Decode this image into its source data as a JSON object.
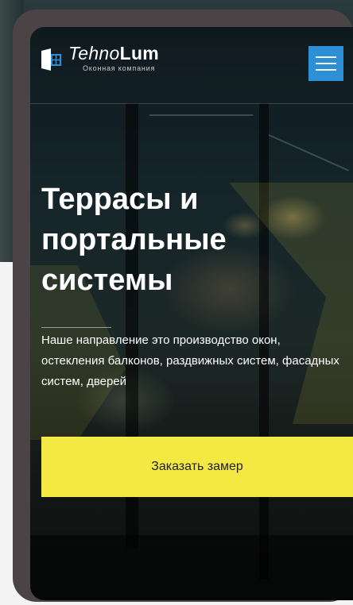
{
  "header": {
    "logo_name_part1": "Tehno",
    "logo_name_part2": "Lum",
    "logo_subtitle": "Оконная компания",
    "menu_icon": "hamburger-menu-icon"
  },
  "hero": {
    "title": "Террасы и портальные системы",
    "description": "Наше направление это производство окон, остекления балконов, раздвижных систем, фасадных систем, дверей",
    "cta_label": "Заказать замер"
  },
  "colors": {
    "menu_button": "#2d8fd6",
    "cta_button": "#f4e843",
    "device_frame": "#4a4446"
  }
}
